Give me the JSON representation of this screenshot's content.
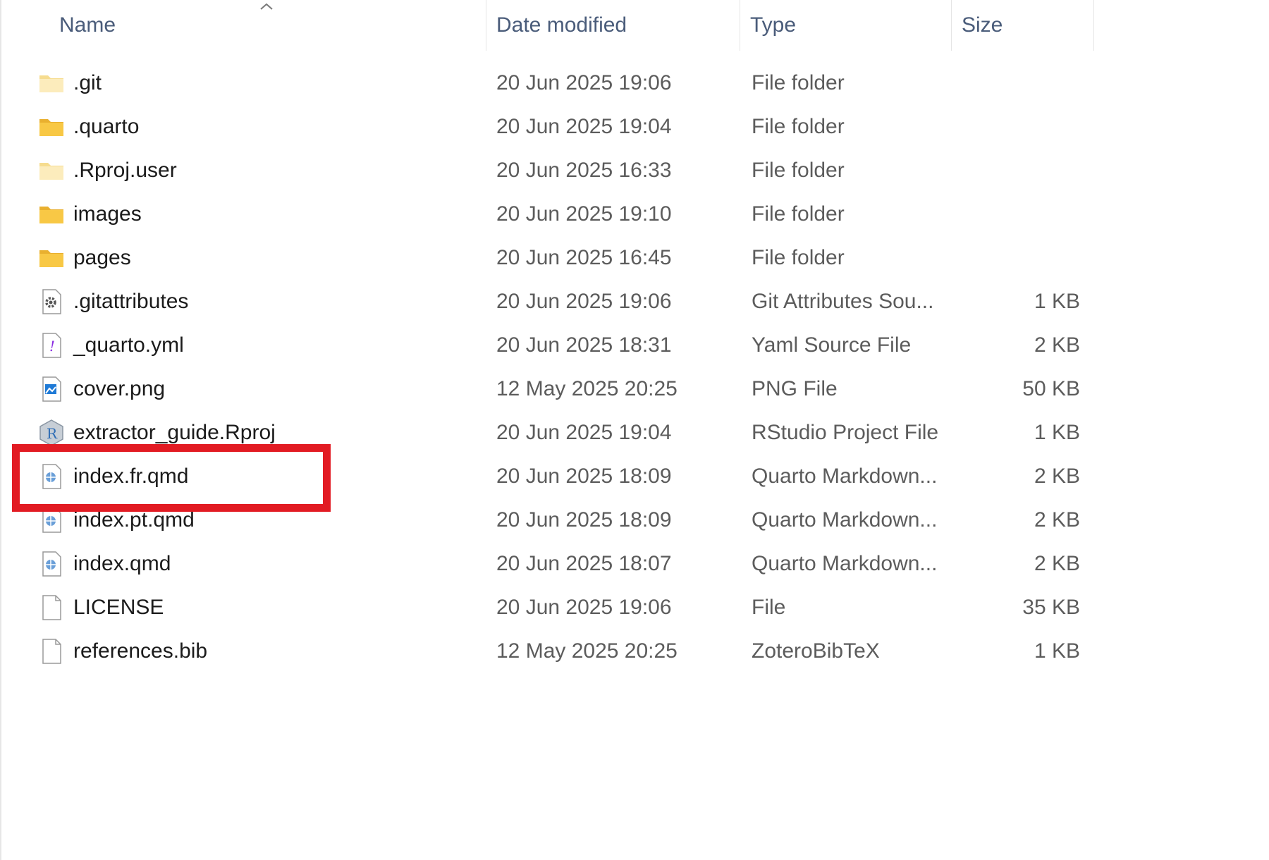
{
  "columns": {
    "name": "Name",
    "date_modified": "Date modified",
    "type": "Type",
    "size": "Size"
  },
  "sort": {
    "column": "name",
    "direction": "ascending",
    "icon": "chevron-up-icon"
  },
  "files": [
    {
      "name": ".git",
      "date": "20 Jun 2025 19:06",
      "type": "File folder",
      "size": "",
      "icon": "folder-hidden-icon"
    },
    {
      "name": ".quarto",
      "date": "20 Jun 2025 19:04",
      "type": "File folder",
      "size": "",
      "icon": "folder-icon"
    },
    {
      "name": ".Rproj.user",
      "date": "20 Jun 2025 16:33",
      "type": "File folder",
      "size": "",
      "icon": "folder-hidden-icon"
    },
    {
      "name": "images",
      "date": "20 Jun 2025 19:10",
      "type": "File folder",
      "size": "",
      "icon": "folder-icon"
    },
    {
      "name": "pages",
      "date": "20 Jun 2025 16:45",
      "type": "File folder",
      "size": "",
      "icon": "folder-icon"
    },
    {
      "name": ".gitattributes",
      "date": "20 Jun 2025 19:06",
      "type": "Git Attributes Sou...",
      "size": "1 KB",
      "icon": "gear-file-icon"
    },
    {
      "name": "_quarto.yml",
      "date": "20 Jun 2025 18:31",
      "type": "Yaml Source File",
      "size": "2 KB",
      "icon": "yaml-file-icon"
    },
    {
      "name": "cover.png",
      "date": "12 May 2025 20:25",
      "type": "PNG File",
      "size": "50 KB",
      "icon": "image-file-icon"
    },
    {
      "name": "extractor_guide.Rproj",
      "date": "20 Jun 2025 19:04",
      "type": "RStudio Project File",
      "size": "1 KB",
      "icon": "rproj-icon"
    },
    {
      "name": "index.fr.qmd",
      "date": "20 Jun 2025 18:09",
      "type": "Quarto Markdown...",
      "size": "2 KB",
      "icon": "quarto-file-icon"
    },
    {
      "name": "index.pt.qmd",
      "date": "20 Jun 2025 18:09",
      "type": "Quarto Markdown...",
      "size": "2 KB",
      "icon": "quarto-file-icon"
    },
    {
      "name": "index.qmd",
      "date": "20 Jun 2025 18:07",
      "type": "Quarto Markdown...",
      "size": "2 KB",
      "icon": "quarto-file-icon"
    },
    {
      "name": "LICENSE",
      "date": "20 Jun 2025 19:06",
      "type": "File",
      "size": "35 KB",
      "icon": "blank-file-icon"
    },
    {
      "name": "references.bib",
      "date": "12 May 2025 20:25",
      "type": "ZoteroBibTeX",
      "size": "1 KB",
      "icon": "blank-file-icon"
    }
  ],
  "highlighted_file": "extractor_guide.Rproj",
  "colors": {
    "highlight": "#e21b23",
    "folder": "#f8c845",
    "header_text": "#4a5c7a"
  }
}
